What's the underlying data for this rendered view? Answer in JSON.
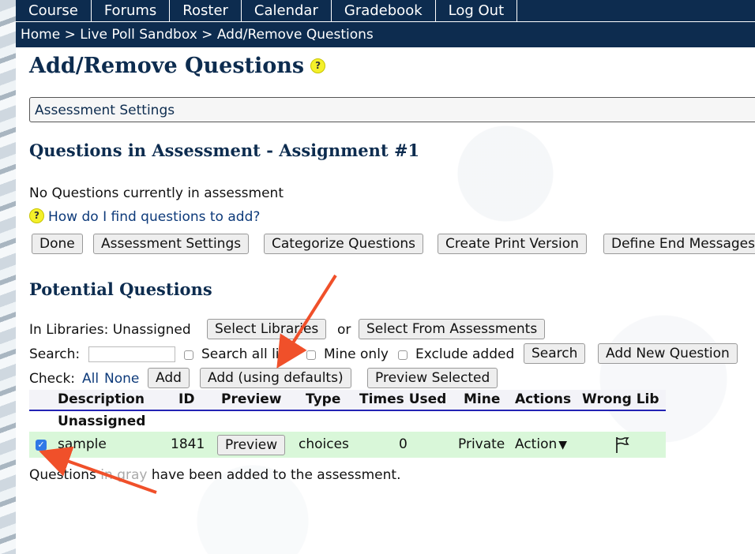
{
  "nav": {
    "items": [
      "Course",
      "Forums",
      "Roster",
      "Calendar",
      "Gradebook",
      "Log Out"
    ]
  },
  "breadcrumb": "Home > Live Poll Sandbox > Add/Remove Questions",
  "page_title": "Add/Remove Questions",
  "help_glyph": "?",
  "assessment_settings_label": "Assessment Settings",
  "in_assessment": {
    "heading": "Questions in Assessment - Assignment #1",
    "empty_message": "No Questions currently in assessment",
    "help_link": "How do I find questions to add?",
    "buttons": {
      "done": "Done",
      "settings": "Assessment Settings",
      "categorize": "Categorize Questions",
      "print": "Create Print Version",
      "end_messages": "Define End Messages"
    }
  },
  "potential": {
    "heading": "Potential Questions",
    "libraries_label": "In Libraries: Unassigned",
    "select_libraries": "Select Libraries",
    "or_text": "or",
    "select_from_assessments": "Select From Assessments",
    "search_label": "Search:",
    "search_value": "",
    "search_all_libs": "Search all libs",
    "mine_only": "Mine only",
    "exclude_added": "Exclude added",
    "search_button": "Search",
    "add_new_question": "Add New Question",
    "check_label": "Check:",
    "check_all": "All",
    "check_none": "None",
    "add_button": "Add",
    "add_defaults_button": "Add (using defaults)",
    "preview_selected_button": "Preview Selected"
  },
  "table": {
    "columns": [
      "Description",
      "ID",
      "Preview",
      "Type",
      "Times Used",
      "Mine",
      "Actions",
      "Wrong Lib"
    ],
    "group": "Unassigned",
    "rows": [
      {
        "checked": true,
        "description": "sample",
        "id": "1841",
        "preview": "Preview",
        "type": "choices",
        "times_used": "0",
        "mine": "Private",
        "action": "Action",
        "action_caret": "▼",
        "wrong_lib_icon": "flag-icon"
      }
    ]
  },
  "footer_note": {
    "before": "Questions ",
    "gray": "in gray",
    "after": " have been added to the assessment."
  },
  "colors": {
    "nav_bg": "#0d2c4f",
    "heading": "#0d2c4f",
    "row_highlight": "#d9f7d9",
    "header_rule": "#2323b4",
    "arrow": "#f0502a"
  }
}
